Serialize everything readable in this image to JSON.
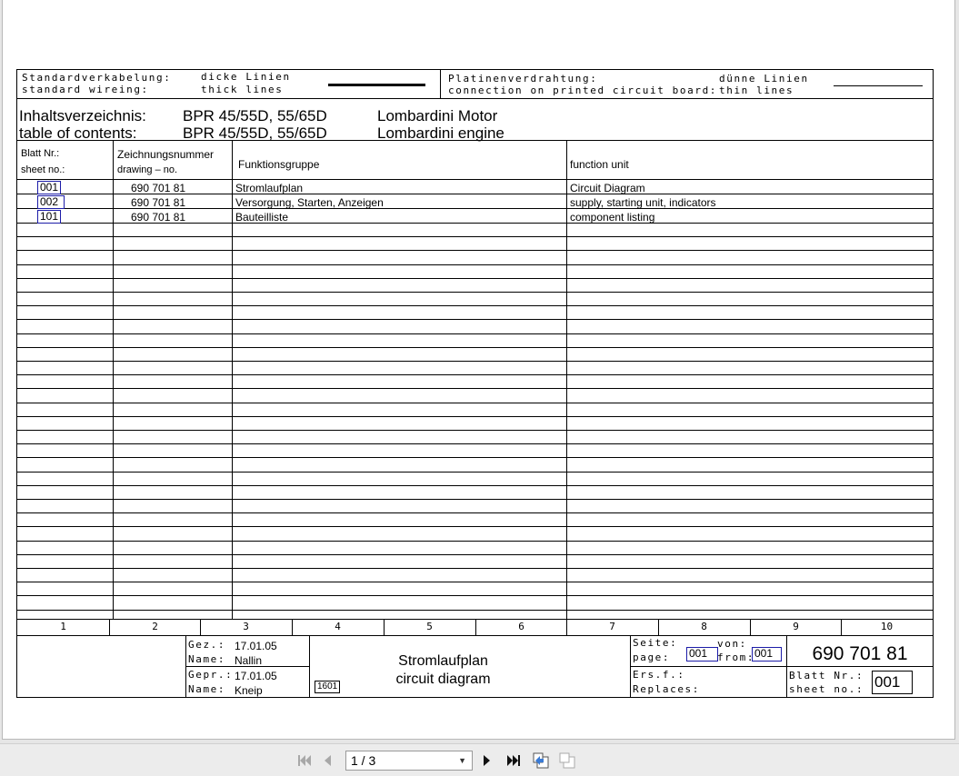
{
  "header": {
    "std_label_de": "Standardverkabelung:",
    "std_label_en": "standard wireing:",
    "thick_de": "dicke Linien",
    "thick_en": "thick lines",
    "pcb_label_de": "Platinenverdrahtung:",
    "pcb_label_en": "connection on printed circuit board:",
    "thin_de": "dünne Linien",
    "thin_en": "thin lines"
  },
  "title": {
    "toc_de": "Inhaltsverzeichnis:",
    "toc_en": "table of contents:",
    "model_de": "BPR 45/55D, 55/65D",
    "model_en": "BPR 45/55D, 55/65D",
    "engine_de": "Lombardini Motor",
    "engine_en": "Lombardini engine"
  },
  "table": {
    "col1_de": "Blatt Nr.:",
    "col1_en": "sheet no.:",
    "col2_de": "Zeichnungsnummer",
    "col2_en": "drawing – no.",
    "col3": "Funktionsgruppe",
    "col4": "function unit",
    "rows": [
      {
        "sheet": "001",
        "drawing": "690 701 81",
        "group": "Stromlaufplan",
        "unit": "Circuit Diagram"
      },
      {
        "sheet": "002",
        "drawing": "690 701 81",
        "group": "Versorgung, Starten, Anzeigen",
        "unit": "supply, starting unit, indicators"
      },
      {
        "sheet": "101",
        "drawing": "690 701 81",
        "group": "Bauteilliste",
        "unit": "component listing"
      }
    ]
  },
  "column_numbers": [
    "1",
    "2",
    "3",
    "4",
    "5",
    "6",
    "7",
    "8",
    "9",
    "10"
  ],
  "title_block": {
    "drawn_label": "Gez.:",
    "drawn_date": "17.01.05",
    "drawn_name_label": "Name:",
    "drawn_name": "Nallin",
    "checked_label": "Gepr.:",
    "checked_date": "17.01.05",
    "checked_name_label": "Name:",
    "checked_name": "Kneip",
    "code": "1601",
    "title_de": "Stromlaufplan",
    "title_en": "circuit diagram",
    "page_label_de": "Seite:",
    "page_label_en": "page:",
    "page_value": "001",
    "of_label_de": "von:",
    "of_label_en": "from:",
    "of_value": "001",
    "drawing_number": "690 701 81",
    "replaces_label_de": "Ers.f.:",
    "replaces_label_en": "Replaces:",
    "sheet_label_de": "Blatt Nr.:",
    "sheet_label_en": "sheet no.:",
    "sheet_value": "001"
  },
  "viewer": {
    "page_indicator": "1 / 3",
    "icons": [
      "first-page-icon",
      "prev-page-icon",
      "next-page-icon",
      "last-page-icon",
      "export-icon",
      "copy-icon"
    ]
  }
}
